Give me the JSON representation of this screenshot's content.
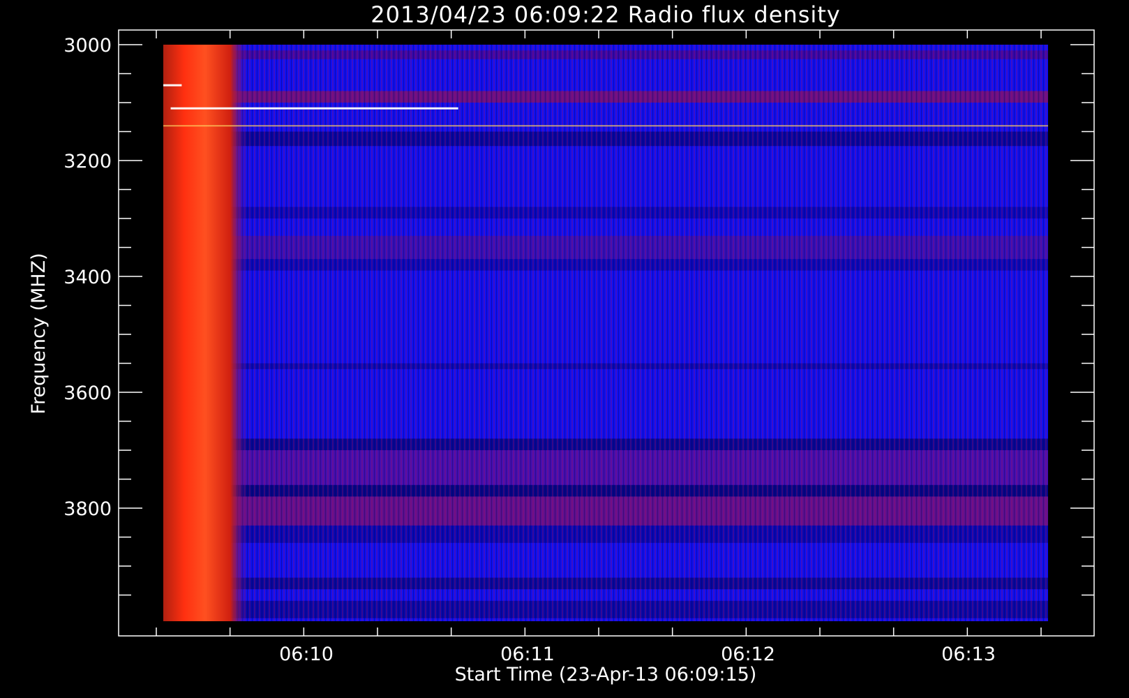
{
  "chart_data": {
    "type": "heatmap",
    "title": "2013/04/23 06:09:22 Radio flux density",
    "xlabel": "Start Time (23-Apr-13 06:09:15)",
    "ylabel": "Frequency (MHZ)",
    "x_tick_labels": [
      "06:10",
      "06:11",
      "06:12",
      "06:13"
    ],
    "y_tick_labels": [
      "3000",
      "3200",
      "3400",
      "3600",
      "3800"
    ],
    "y_ticks": [
      3000,
      3200,
      3400,
      3600,
      3800
    ],
    "ylim": [
      3000,
      4000
    ],
    "xlim": [
      "06:09:15",
      "06:13:15"
    ],
    "y_inverted": true,
    "colormap": [
      "#000000",
      "#0000ff",
      "#ff0000",
      "#ffff00",
      "#ffffff"
    ],
    "background_level": "blue",
    "burst": {
      "time_range": [
        "06:09:15",
        "06:09:34"
      ],
      "frequency_range": [
        3000,
        4000
      ],
      "color": "red-orange"
    },
    "features": [
      {
        "type": "bright line",
        "frequency": 3110,
        "time_range": [
          "06:09:17",
          "06:10:35"
        ],
        "color": "white"
      },
      {
        "type": "bright line",
        "frequency": 3070,
        "time_range": [
          "06:09:15",
          "06:09:20"
        ],
        "color": "white"
      },
      {
        "type": "line",
        "frequency": 3140,
        "time_range": [
          "06:09:15",
          "06:13:15"
        ],
        "color": "yellow/black"
      },
      {
        "type": "red band",
        "frequency_range": [
          3680,
          3830
        ],
        "time_range": [
          "06:09:15",
          "06:13:15"
        ]
      }
    ]
  }
}
